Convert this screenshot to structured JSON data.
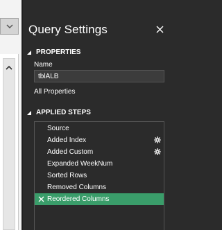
{
  "panel": {
    "title": "Query Settings"
  },
  "properties": {
    "header": "PROPERTIES",
    "name_label": "Name",
    "name_value": "tblALB",
    "all_properties_link": "All Properties"
  },
  "applied_steps": {
    "header": "APPLIED STEPS",
    "steps": [
      {
        "label": "Source"
      },
      {
        "label": "Added Index"
      },
      {
        "label": "Added Custom"
      },
      {
        "label": "Expanded WeekNum"
      },
      {
        "label": "Sorted Rows"
      },
      {
        "label": "Removed Columns"
      },
      {
        "label": "Reordered Columns"
      }
    ]
  },
  "colors": {
    "accent": "#3a9d6a",
    "panel_bg": "#2b2b2b"
  },
  "icons": [
    "chevron-down-icon",
    "chevron-up-icon",
    "close-icon",
    "collapse-triangle-icon",
    "gear-icon",
    "delete-step-icon"
  ]
}
